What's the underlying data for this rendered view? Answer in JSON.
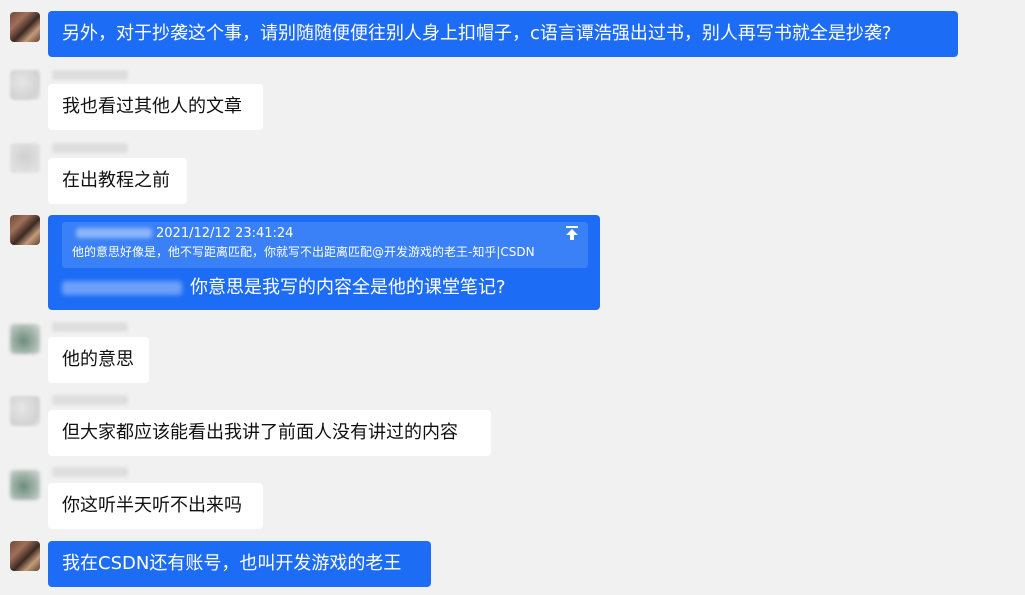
{
  "messages": [
    {
      "text": "另外，对于抄袭这个事，请别随随便便往别人身上扣帽子，c语言谭浩强出过书，别人再写书就全是抄袭?"
    },
    {
      "text": "我也看过其他人的文章"
    },
    {
      "text": "在出教程之前"
    },
    {
      "quote_time": "2021/12/12 23:41:24",
      "quote_text": "他的意思好像是，他不写距离匹配，你就写不出距离匹配@开发游戏的老王-知乎|CSDN",
      "reply_text": "你意思是我写的内容全是他的课堂笔记?"
    },
    {
      "text": "他的意思"
    },
    {
      "text": "但大家都应该能看出我讲了前面人没有讲过的内容"
    },
    {
      "text": "你这听半天听不出来吗"
    },
    {
      "text": "我在CSDN还有账号，也叫开发游戏的老王"
    }
  ],
  "colors": {
    "background": "#f1f1f1",
    "outgoing_bubble": "#1d6cf5",
    "incoming_bubble": "#ffffff",
    "quote_box": "#3a80f6"
  },
  "icons": {
    "avatar_self": "user-avatar-icon",
    "quote_jump": "scroll-to-top-icon"
  }
}
